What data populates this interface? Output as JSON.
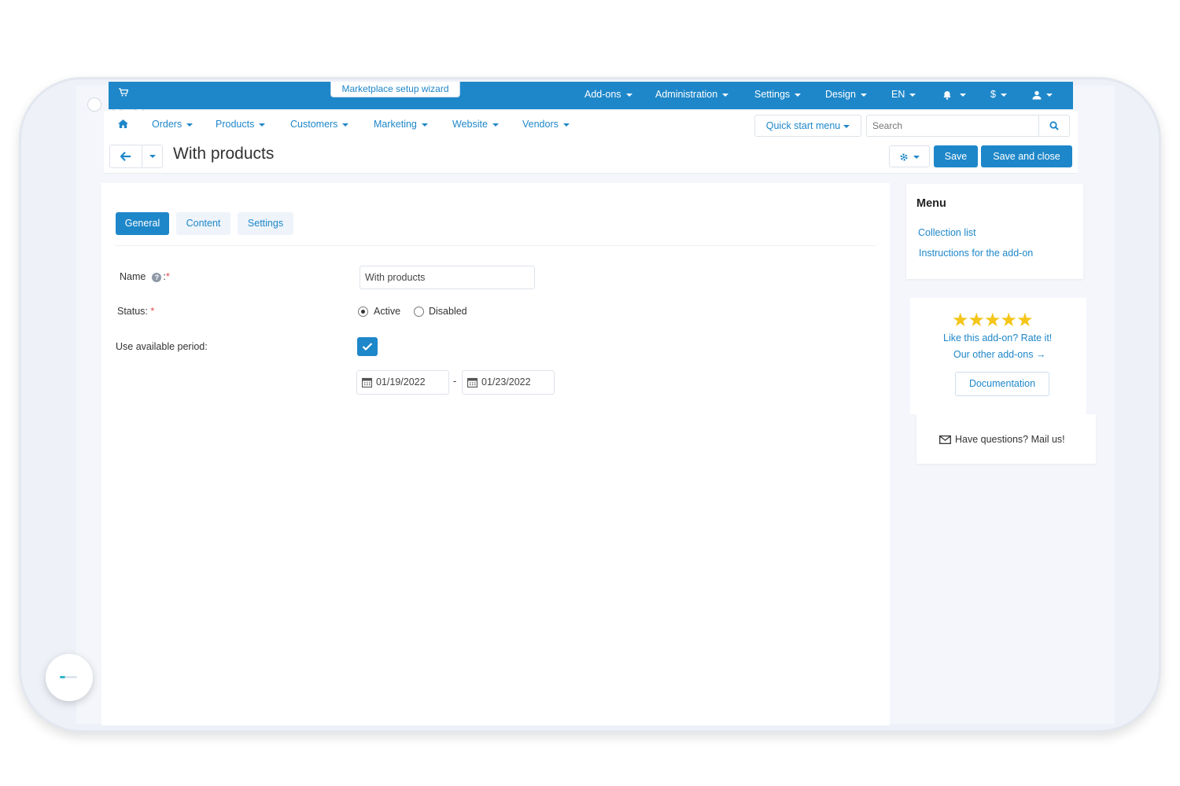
{
  "topbar": {
    "wizard_label": "Marketplace setup wizard",
    "menus": [
      "Add-ons",
      "Administration",
      "Settings",
      "Design",
      "EN",
      "$"
    ]
  },
  "nav": {
    "items": [
      "Orders",
      "Products",
      "Customers",
      "Marketing",
      "Website",
      "Vendors"
    ],
    "quick_start": "Quick start menu",
    "search_placeholder": "Search"
  },
  "header": {
    "title": "With products",
    "save": "Save",
    "save_close": "Save and close"
  },
  "tabs": [
    "General",
    "Content",
    "Settings"
  ],
  "active_tab": "General",
  "form": {
    "name_label": "Name",
    "name_suffix": ":",
    "name_value": "With products",
    "status_label": "Status:",
    "status_options": [
      "Active",
      "Disabled"
    ],
    "status_selected": "Active",
    "period_label": "Use available period:",
    "period_checked": true,
    "date_from": "01/19/2022",
    "date_to": "01/23/2022",
    "date_sep": "-",
    "required_mark": "*"
  },
  "sidebar": {
    "menu_title": "Menu",
    "links": [
      "Collection list",
      "Instructions for the add-on"
    ],
    "rating_stars": 5,
    "rate_text": "Like this add-on? Rate it!",
    "other_addons": "Our other add-ons →",
    "documentation": "Documentation",
    "questions": "Have questions? Mail us!"
  },
  "colors": {
    "accent": "#1e87c9",
    "star": "#f5c518"
  }
}
